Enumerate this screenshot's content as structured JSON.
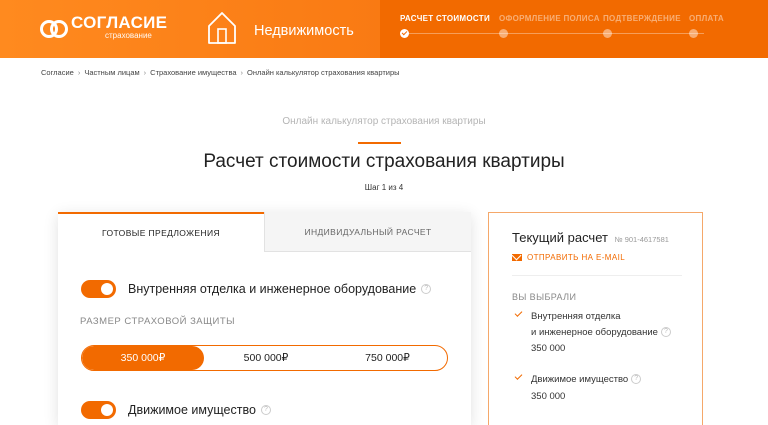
{
  "header": {
    "logo_name": "СОГЛАСИЕ",
    "logo_sub": "страхование",
    "product": "Недвижимость",
    "steps": [
      {
        "label": "Расчет стоимости",
        "active": true
      },
      {
        "label": "Оформление полиса",
        "active": false
      },
      {
        "label": "Подтверждение",
        "active": false
      },
      {
        "label": "Оплата",
        "active": false
      }
    ]
  },
  "breadcrumb": [
    "Согласие",
    "Частным лицам",
    "Страхование имущества",
    "Онлайн калькулятор страхования квартиры"
  ],
  "page": {
    "kicker": "Онлайн калькулятор страхования квартиры",
    "title": "Расчет стоимости страхования квартиры",
    "step_counter": "Шаг 1 из 4"
  },
  "calculator": {
    "tabs": [
      "Готовые предложения",
      "Индивидуальный расчет"
    ],
    "option1_label": "Внутренняя отделка и инженерное оборудование",
    "coverage_label": "Размер страховой защиты",
    "amounts": [
      "350 000₽",
      "500 000₽",
      "750 000₽"
    ],
    "option2_label": "Движимое имущество"
  },
  "summary": {
    "title": "Текущий расчет",
    "number": "№ 901-4617581",
    "email": "Отправить на e-mail",
    "chosen_label": "Вы выбрали",
    "items": [
      {
        "line1": "Внутренняя отделка",
        "line2": "и инженерное оборудование",
        "value": "350 000"
      },
      {
        "line1": "Движимое имущество",
        "value": "350 000"
      }
    ]
  },
  "colors": {
    "accent": "#f26a00",
    "header_gradient_start": "#ff8a1f"
  }
}
